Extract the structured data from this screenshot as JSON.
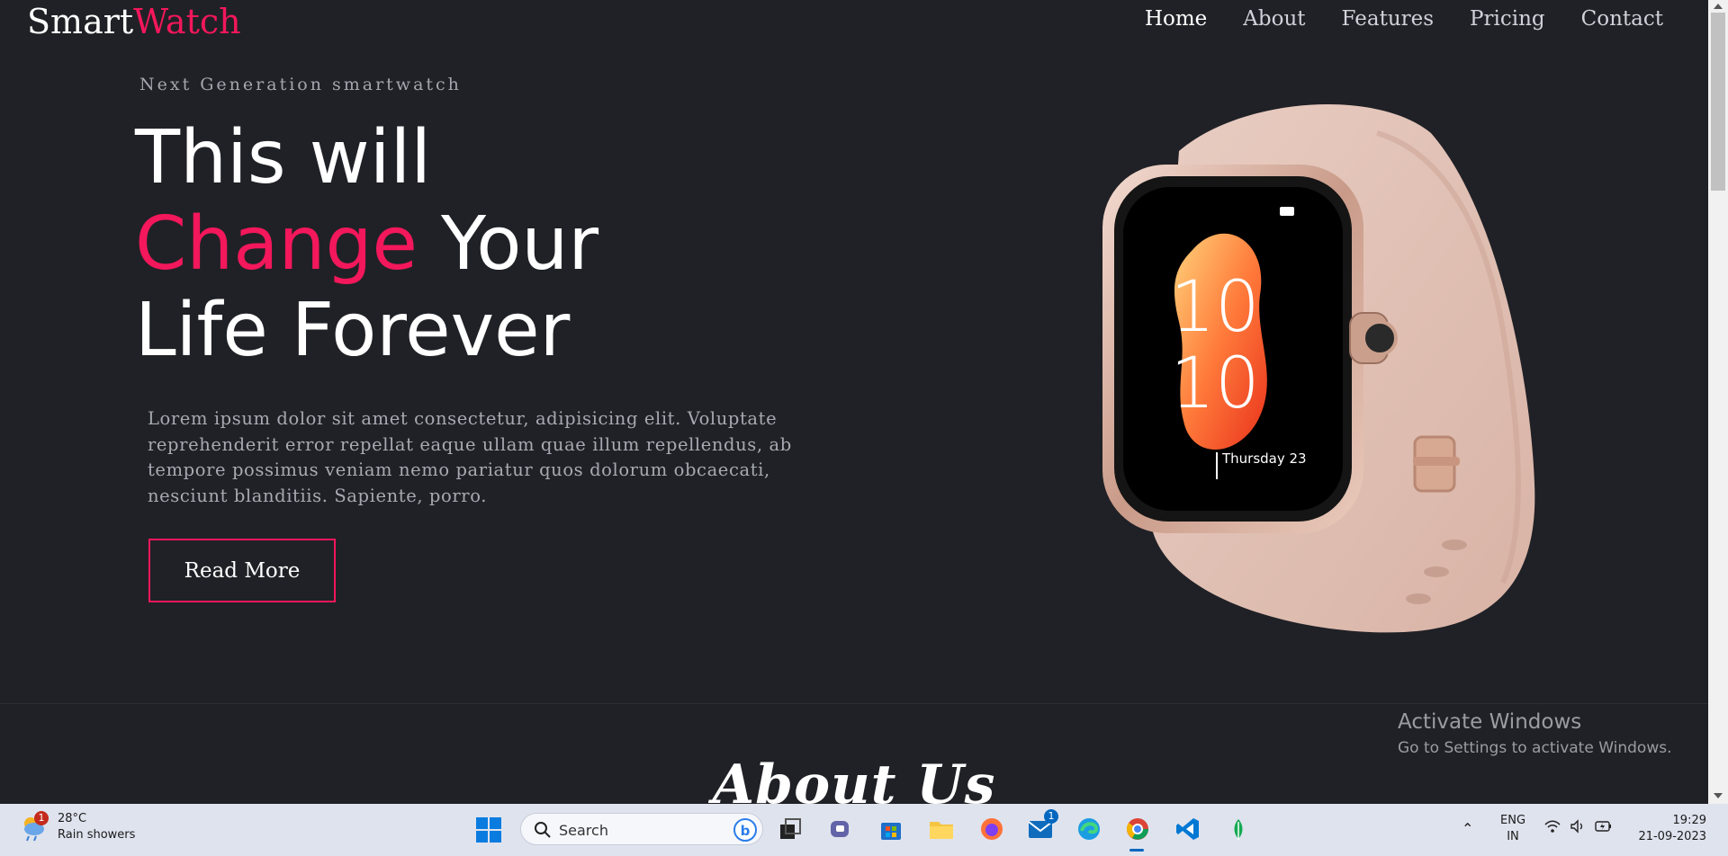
{
  "brand": {
    "part1": "Smart",
    "part2": "Watch"
  },
  "nav": [
    {
      "label": "Home",
      "active": true
    },
    {
      "label": "About",
      "active": false
    },
    {
      "label": "Features",
      "active": false
    },
    {
      "label": "Pricing",
      "active": false
    },
    {
      "label": "Contact",
      "active": false
    }
  ],
  "hero": {
    "eyebrow": "Next Generation smartwatch",
    "line1": "This will",
    "line2_accent": "Change",
    "line2_rest": " Your",
    "line3": "Life Forever",
    "lede": "Lorem ipsum dolor sit amet consectetur, adipisicing elit. Voluptate reprehenderit error repellat eaque ullam quae illum repellendus, ab tempore possimus veniam nemo pariatur quos dolorum obcaecati, nesciunt blanditiis. Sapiente, porro.",
    "cta": "Read More",
    "watch_time_top": "10",
    "watch_time_bottom": "10",
    "watch_date": "Thursday 23"
  },
  "about": {
    "title": "About Us"
  },
  "watermark": {
    "title": "Activate Windows",
    "subtitle": "Go to Settings to activate Windows."
  },
  "colors": {
    "accent": "#f3175b",
    "background": "#202126",
    "text_muted": "#a7aab2"
  },
  "taskbar": {
    "weather_badge": "1",
    "temperature": "28°C",
    "condition": "Rain showers",
    "search_placeholder": "Search",
    "mail_badge": "1",
    "lang_line1": "ENG",
    "lang_line2": "IN",
    "time": "19:29",
    "date": "21-09-2023",
    "icons": [
      "windows-start-icon",
      "task-view-icon",
      "teams-icon",
      "store-icon",
      "file-explorer-icon",
      "firefox-icon",
      "mail-icon",
      "edge-icon",
      "chrome-icon",
      "vscode-icon",
      "mongodb-icon"
    ]
  }
}
